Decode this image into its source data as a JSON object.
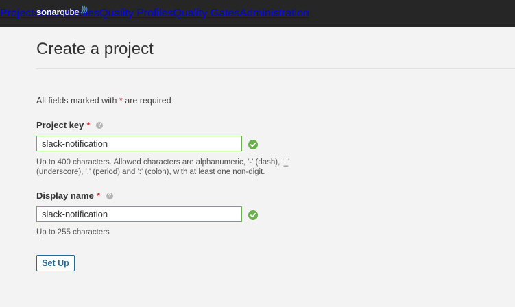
{
  "header": {
    "logo": {
      "sonar": "sonar",
      "qube": "qube"
    },
    "nav": [
      {
        "label": "Projects"
      },
      {
        "label": "Issues"
      },
      {
        "label": "Rules"
      },
      {
        "label": "Quality Profiles"
      },
      {
        "label": "Quality Gates"
      },
      {
        "label": "Administration"
      }
    ]
  },
  "page": {
    "title": "Create a project",
    "required_note_before": "All fields marked with",
    "required_star": "*",
    "required_note_after": "are required"
  },
  "form": {
    "project_key": {
      "label": "Project key",
      "star": "*",
      "help_icon": "?",
      "value": "slack-notification",
      "hint_line1": "Up to 400 characters. Allowed characters are alphanumeric, '-' (dash), '_'",
      "hint_line2": "(underscore), '.' (period) and ':' (colon), with at least one non-digit."
    },
    "display_name": {
      "label": "Display name",
      "star": "*",
      "help_icon": "?",
      "value": "slack-notification",
      "hint": "Up to 255 characters"
    },
    "submit_label": "Set Up"
  },
  "colors": {
    "topbar": "#262626",
    "valid": "#6ab04c",
    "required": "#d02f3a",
    "primary": "#236a97"
  }
}
